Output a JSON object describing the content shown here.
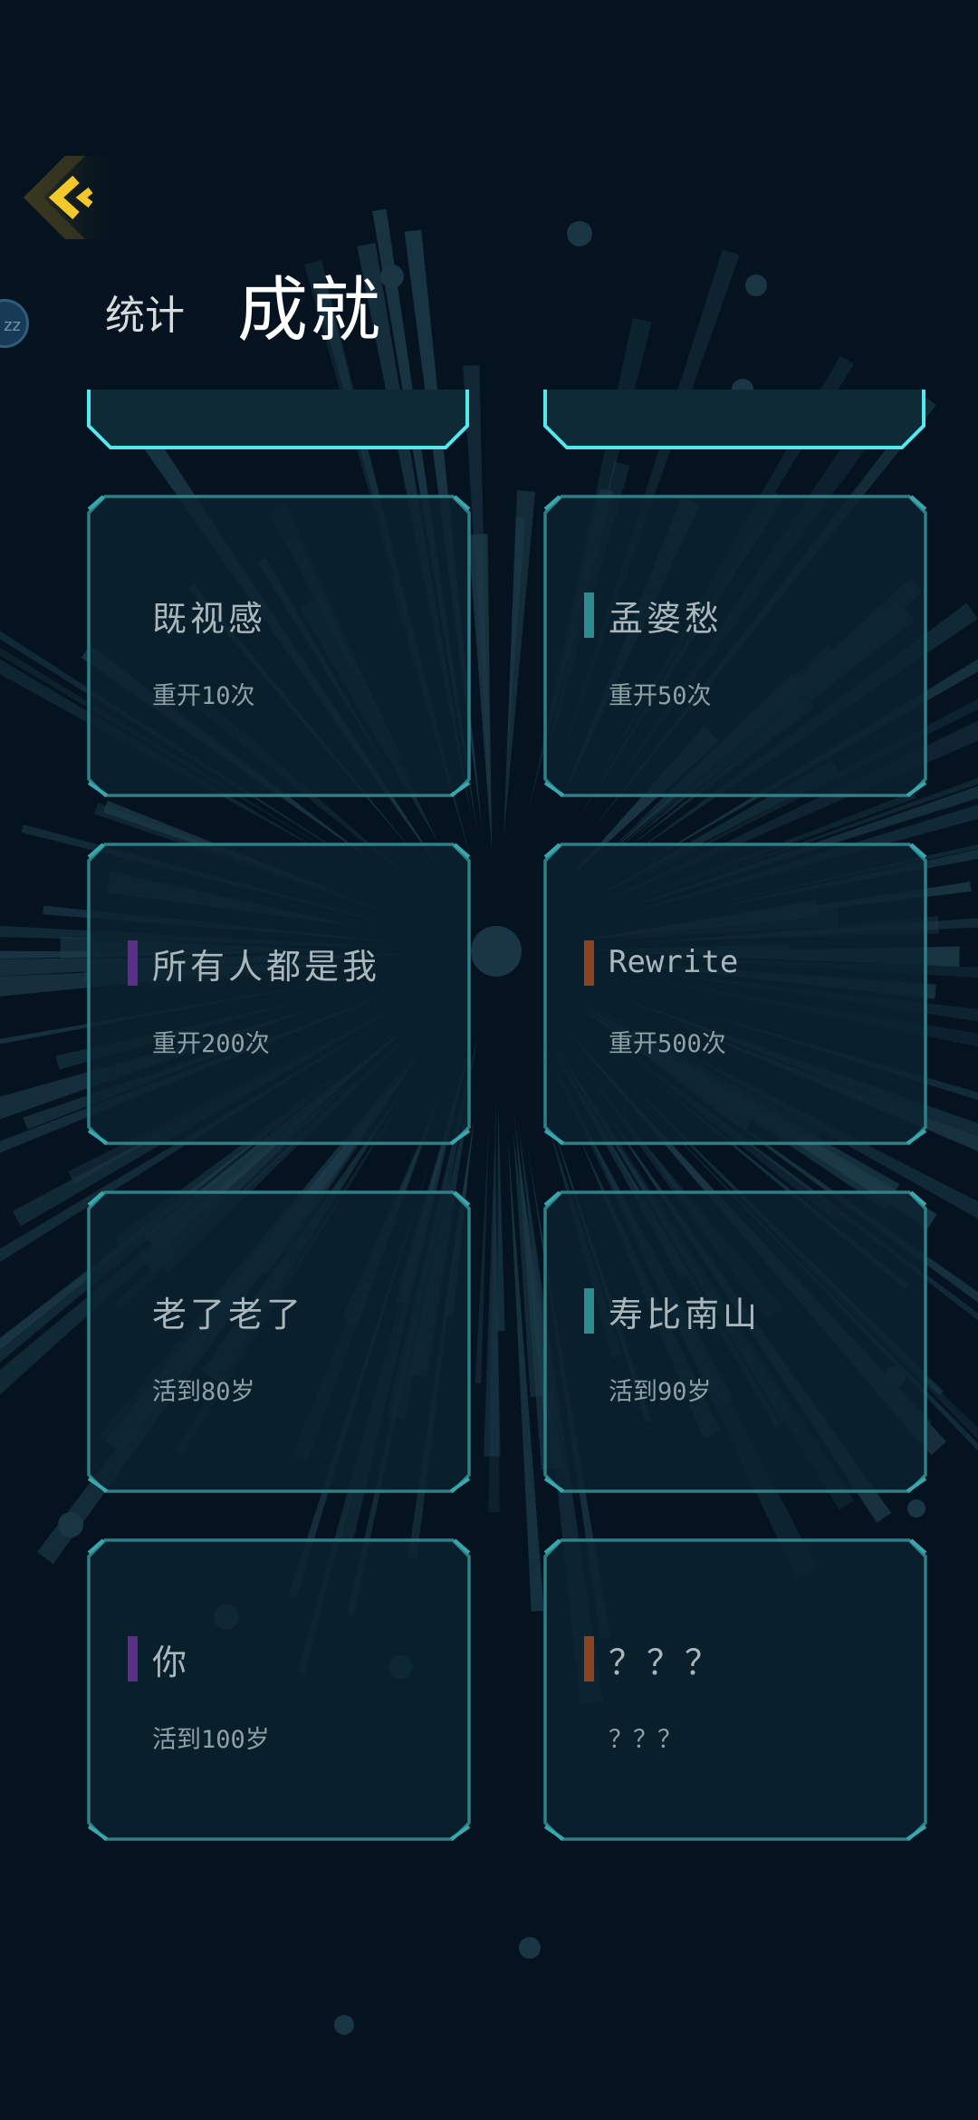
{
  "header": {
    "side_bubble": "zz",
    "tabs": [
      {
        "label": "统计",
        "active": false
      },
      {
        "label": "成就",
        "active": true
      }
    ]
  },
  "colors": {
    "background": "#04131f",
    "card_border": "#2e7f86",
    "header_border": "#52e8ee",
    "back_accent": "#f4c829",
    "marker_teal": "#2f8b90",
    "marker_purple": "#5b2e8c",
    "marker_orange": "#8a4520"
  },
  "achievements": [
    {
      "title": "既视感",
      "desc": "重开10次",
      "marker": "none"
    },
    {
      "title": "孟婆愁",
      "desc": "重开50次",
      "marker": "teal"
    },
    {
      "title": "所有人都是我",
      "desc": "重开200次",
      "marker": "purple"
    },
    {
      "title": "Rewrite",
      "desc": "重开500次",
      "marker": "orange"
    },
    {
      "title": "老了老了",
      "desc": "活到80岁",
      "marker": "none"
    },
    {
      "title": "寿比南山",
      "desc": "活到90岁",
      "marker": "teal"
    },
    {
      "title": "你",
      "desc": "活到100岁",
      "marker": "purple"
    },
    {
      "title": "？？？",
      "desc": "？？？",
      "marker": "orange"
    }
  ]
}
